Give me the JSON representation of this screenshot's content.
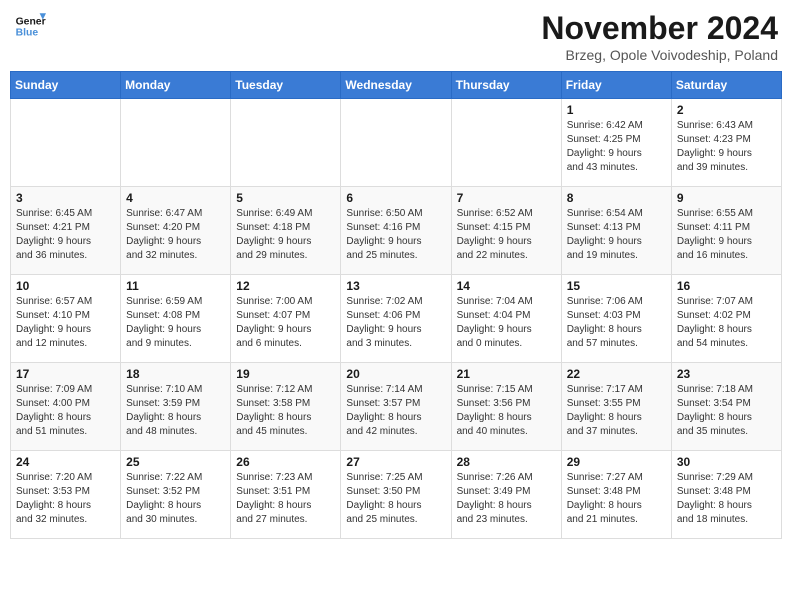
{
  "logo": {
    "line1": "General",
    "line2": "Blue"
  },
  "title": "November 2024",
  "subtitle": "Brzeg, Opole Voivodeship, Poland",
  "days_of_week": [
    "Sunday",
    "Monday",
    "Tuesday",
    "Wednesday",
    "Thursday",
    "Friday",
    "Saturday"
  ],
  "weeks": [
    [
      {
        "day": "",
        "info": ""
      },
      {
        "day": "",
        "info": ""
      },
      {
        "day": "",
        "info": ""
      },
      {
        "day": "",
        "info": ""
      },
      {
        "day": "",
        "info": ""
      },
      {
        "day": "1",
        "info": "Sunrise: 6:42 AM\nSunset: 4:25 PM\nDaylight: 9 hours\nand 43 minutes."
      },
      {
        "day": "2",
        "info": "Sunrise: 6:43 AM\nSunset: 4:23 PM\nDaylight: 9 hours\nand 39 minutes."
      }
    ],
    [
      {
        "day": "3",
        "info": "Sunrise: 6:45 AM\nSunset: 4:21 PM\nDaylight: 9 hours\nand 36 minutes."
      },
      {
        "day": "4",
        "info": "Sunrise: 6:47 AM\nSunset: 4:20 PM\nDaylight: 9 hours\nand 32 minutes."
      },
      {
        "day": "5",
        "info": "Sunrise: 6:49 AM\nSunset: 4:18 PM\nDaylight: 9 hours\nand 29 minutes."
      },
      {
        "day": "6",
        "info": "Sunrise: 6:50 AM\nSunset: 4:16 PM\nDaylight: 9 hours\nand 25 minutes."
      },
      {
        "day": "7",
        "info": "Sunrise: 6:52 AM\nSunset: 4:15 PM\nDaylight: 9 hours\nand 22 minutes."
      },
      {
        "day": "8",
        "info": "Sunrise: 6:54 AM\nSunset: 4:13 PM\nDaylight: 9 hours\nand 19 minutes."
      },
      {
        "day": "9",
        "info": "Sunrise: 6:55 AM\nSunset: 4:11 PM\nDaylight: 9 hours\nand 16 minutes."
      }
    ],
    [
      {
        "day": "10",
        "info": "Sunrise: 6:57 AM\nSunset: 4:10 PM\nDaylight: 9 hours\nand 12 minutes."
      },
      {
        "day": "11",
        "info": "Sunrise: 6:59 AM\nSunset: 4:08 PM\nDaylight: 9 hours\nand 9 minutes."
      },
      {
        "day": "12",
        "info": "Sunrise: 7:00 AM\nSunset: 4:07 PM\nDaylight: 9 hours\nand 6 minutes."
      },
      {
        "day": "13",
        "info": "Sunrise: 7:02 AM\nSunset: 4:06 PM\nDaylight: 9 hours\nand 3 minutes."
      },
      {
        "day": "14",
        "info": "Sunrise: 7:04 AM\nSunset: 4:04 PM\nDaylight: 9 hours\nand 0 minutes."
      },
      {
        "day": "15",
        "info": "Sunrise: 7:06 AM\nSunset: 4:03 PM\nDaylight: 8 hours\nand 57 minutes."
      },
      {
        "day": "16",
        "info": "Sunrise: 7:07 AM\nSunset: 4:02 PM\nDaylight: 8 hours\nand 54 minutes."
      }
    ],
    [
      {
        "day": "17",
        "info": "Sunrise: 7:09 AM\nSunset: 4:00 PM\nDaylight: 8 hours\nand 51 minutes."
      },
      {
        "day": "18",
        "info": "Sunrise: 7:10 AM\nSunset: 3:59 PM\nDaylight: 8 hours\nand 48 minutes."
      },
      {
        "day": "19",
        "info": "Sunrise: 7:12 AM\nSunset: 3:58 PM\nDaylight: 8 hours\nand 45 minutes."
      },
      {
        "day": "20",
        "info": "Sunrise: 7:14 AM\nSunset: 3:57 PM\nDaylight: 8 hours\nand 42 minutes."
      },
      {
        "day": "21",
        "info": "Sunrise: 7:15 AM\nSunset: 3:56 PM\nDaylight: 8 hours\nand 40 minutes."
      },
      {
        "day": "22",
        "info": "Sunrise: 7:17 AM\nSunset: 3:55 PM\nDaylight: 8 hours\nand 37 minutes."
      },
      {
        "day": "23",
        "info": "Sunrise: 7:18 AM\nSunset: 3:54 PM\nDaylight: 8 hours\nand 35 minutes."
      }
    ],
    [
      {
        "day": "24",
        "info": "Sunrise: 7:20 AM\nSunset: 3:53 PM\nDaylight: 8 hours\nand 32 minutes."
      },
      {
        "day": "25",
        "info": "Sunrise: 7:22 AM\nSunset: 3:52 PM\nDaylight: 8 hours\nand 30 minutes."
      },
      {
        "day": "26",
        "info": "Sunrise: 7:23 AM\nSunset: 3:51 PM\nDaylight: 8 hours\nand 27 minutes."
      },
      {
        "day": "27",
        "info": "Sunrise: 7:25 AM\nSunset: 3:50 PM\nDaylight: 8 hours\nand 25 minutes."
      },
      {
        "day": "28",
        "info": "Sunrise: 7:26 AM\nSunset: 3:49 PM\nDaylight: 8 hours\nand 23 minutes."
      },
      {
        "day": "29",
        "info": "Sunrise: 7:27 AM\nSunset: 3:48 PM\nDaylight: 8 hours\nand 21 minutes."
      },
      {
        "day": "30",
        "info": "Sunrise: 7:29 AM\nSunset: 3:48 PM\nDaylight: 8 hours\nand 18 minutes."
      }
    ]
  ]
}
